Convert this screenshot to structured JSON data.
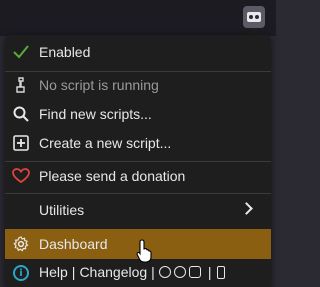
{
  "menu": {
    "enabled_label": "Enabled",
    "no_script_label": "No script is running",
    "find_scripts_label": "Find new scripts...",
    "create_script_label": "Create a new script...",
    "donation_label": "Please send a donation",
    "utilities_label": "Utilities",
    "dashboard_label": "Dashboard"
  },
  "footer": {
    "help_label": "Help",
    "separator": "|",
    "changelog_label": "Changelog"
  },
  "colors": {
    "accent_check": "#5aaa3a",
    "heart": "#e0443f",
    "highlight": "#8a5f12",
    "info": "#2aa6c7"
  },
  "icons": [
    "check-icon",
    "script-icon",
    "search-icon",
    "add-box-icon",
    "heart-icon",
    "chevron-right-icon",
    "gear-icon",
    "info-icon",
    "github-icon",
    "facebook-icon",
    "instagram-icon",
    "mobile-icon",
    "ext-toolbar-icon",
    "pointer-cursor-icon"
  ]
}
